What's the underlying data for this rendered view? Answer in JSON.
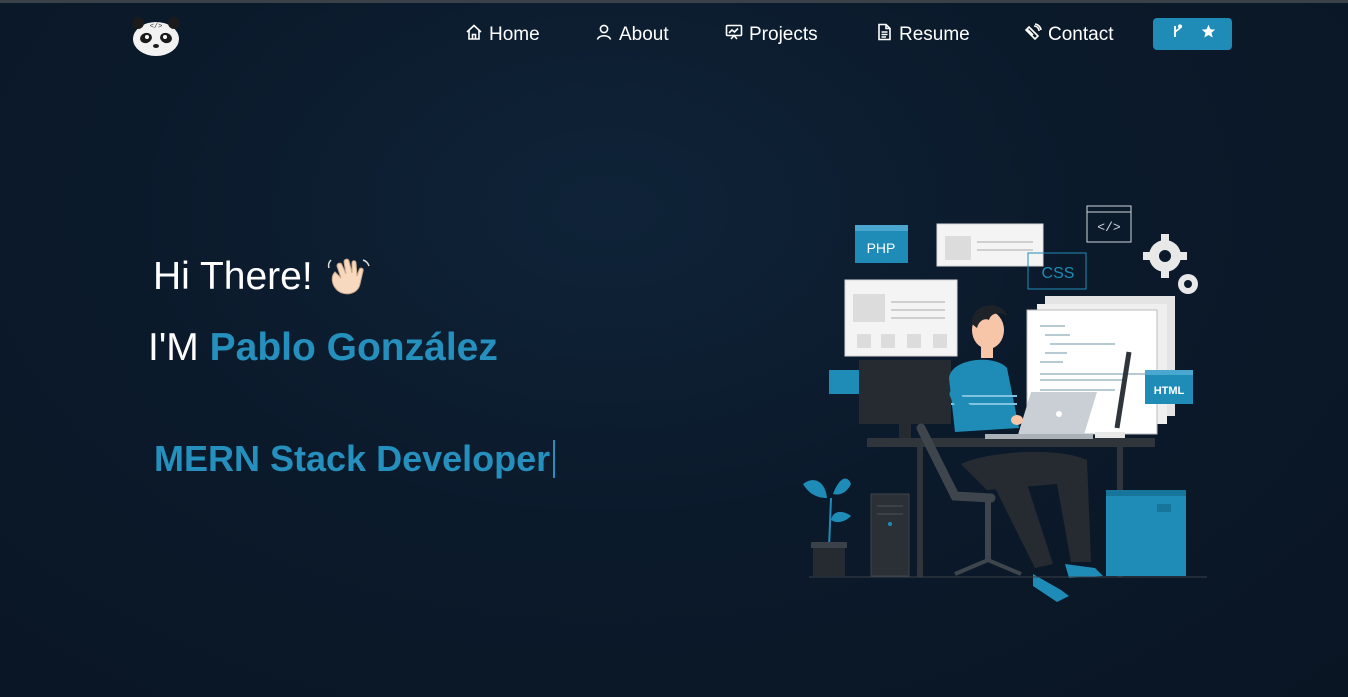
{
  "nav": {
    "logo_icon": "panda-logo-icon",
    "items": [
      {
        "label": "Home",
        "icon": "home-icon"
      },
      {
        "label": "About",
        "icon": "user-icon"
      },
      {
        "label": "Projects",
        "icon": "presentation-icon"
      },
      {
        "label": "Resume",
        "icon": "document-icon"
      },
      {
        "label": "Contact",
        "icon": "satellite-icon"
      }
    ],
    "github_button": {
      "icons": [
        "fork-icon",
        "star-icon"
      ],
      "color": "#1f8cb7"
    }
  },
  "hero": {
    "greeting": "Hi There!",
    "wave_icon": "waving-hand-icon",
    "intro_prefix": "I'M",
    "name": "Pablo González",
    "role": "MERN Stack Developer",
    "accent_color": "#2590bd"
  },
  "illustration": {
    "labels": {
      "php": "PHP",
      "css": "CSS",
      "html": "HTML"
    }
  },
  "colors": {
    "background": "#0b1a2b",
    "accent": "#2590bd",
    "button": "#1f8cb7"
  }
}
